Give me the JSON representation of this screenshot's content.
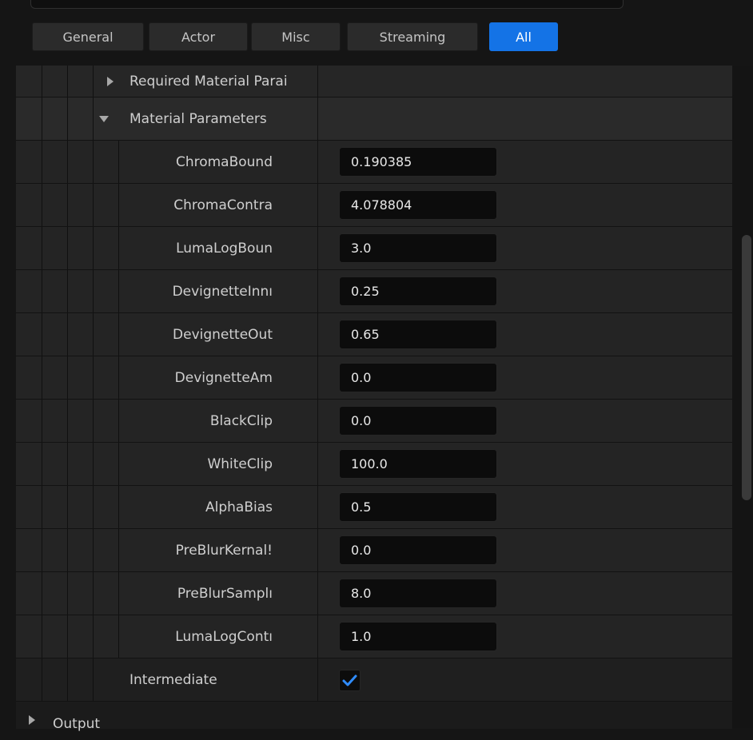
{
  "tabs": [
    {
      "label": "General"
    },
    {
      "label": "Actor"
    },
    {
      "label": "Misc"
    },
    {
      "label": "Streaming"
    },
    {
      "label": "All"
    }
  ],
  "active_tab": "All",
  "groups": {
    "required": {
      "label": "Required Material Parai"
    },
    "material": {
      "label": "Material Parameters"
    }
  },
  "params": [
    {
      "name": "ChromaBound",
      "value": "0.190385"
    },
    {
      "name": "ChromaContra",
      "value": "4.078804"
    },
    {
      "name": "LumaLogBoun",
      "value": "3.0"
    },
    {
      "name": "DevignetteInnı",
      "value": "0.25"
    },
    {
      "name": "DevignetteOut",
      "value": "0.65"
    },
    {
      "name": "DevignetteAm",
      "value": "0.0"
    },
    {
      "name": "BlackClip",
      "value": "0.0"
    },
    {
      "name": "WhiteClip",
      "value": "100.0"
    },
    {
      "name": "AlphaBias",
      "value": "0.5"
    },
    {
      "name": "PreBlurKernal!",
      "value": "0.0"
    },
    {
      "name": "PreBlurSamplı",
      "value": "8.0"
    },
    {
      "name": "LumaLogContı",
      "value": "1.0"
    }
  ],
  "intermediate": {
    "label": "Intermediate",
    "checked": true
  },
  "output": {
    "label": "Output"
  },
  "colors": {
    "accent": "#1473e6",
    "checkmark": "#2f8cff"
  },
  "icons": [
    "expand-right-icon",
    "collapse-down-icon",
    "checkmark-icon"
  ]
}
